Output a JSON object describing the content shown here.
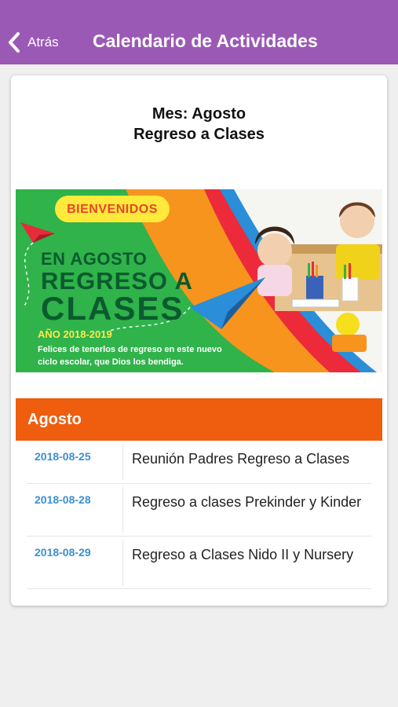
{
  "nav": {
    "back_label": "Atrás",
    "title": "Calendario de Actividades",
    "color": "#9b59b6"
  },
  "card": {
    "month_line": "Mes: Agosto",
    "subtitle": "Regreso a Clases"
  },
  "banner": {
    "welcome": "BIENVENIDOS",
    "line1": "EN AGOSTO",
    "line2": "REGRESO A",
    "line3": "CLASES",
    "year": "AÑO 2018-2019",
    "message": "Felices de tenerlos de regreso en este nuevo ciclo escolar, que Dios los bendiga."
  },
  "month_section": {
    "label": "Agosto",
    "color": "#ef5d0f"
  },
  "events": [
    {
      "date": "2018-08-25",
      "title": "Reunión Padres Regreso a Clases"
    },
    {
      "date": "2018-08-28",
      "title": "Regreso a clases Prekinder y Kinder"
    },
    {
      "date": "2018-08-29",
      "title": "Regreso a Clases Nido II y Nursery"
    }
  ]
}
